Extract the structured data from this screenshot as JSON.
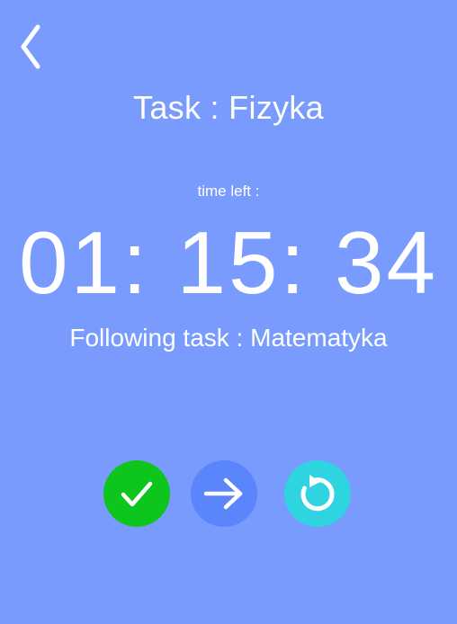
{
  "header": {
    "back_icon": "chevron-left-icon"
  },
  "task": {
    "title": "Task : Fizyka"
  },
  "timer": {
    "label": "time left :",
    "value": "01: 15: 34"
  },
  "next_task": {
    "text": "Following task : Matematyka"
  },
  "actions": [
    {
      "icon": "checkmark-icon",
      "color": "#0ec51e"
    },
    {
      "icon": "arrow-right-icon",
      "color": "#5a85fb"
    },
    {
      "icon": "restart-icon",
      "color": "#2ed5e0"
    }
  ],
  "colors": {
    "background": "#789bfd",
    "text": "#ffffff"
  }
}
